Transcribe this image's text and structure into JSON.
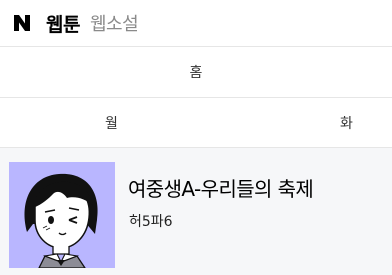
{
  "header": {
    "logo_icon": "naver-n-logo",
    "tab_webtoon": "웹툰",
    "tab_novel": "웹소설"
  },
  "home": {
    "label": "홈"
  },
  "days": [
    {
      "label": "월"
    },
    {
      "label": "화"
    }
  ],
  "webtoon": {
    "title": "여중생A-우리들의 축제",
    "author": "허5파6",
    "thumbnail_bg": "#b9b6ff"
  },
  "colors": {
    "inactive_tab": "#8a8a8a",
    "content_bg": "#f6f7f9",
    "divider": "#e6e6e6"
  }
}
